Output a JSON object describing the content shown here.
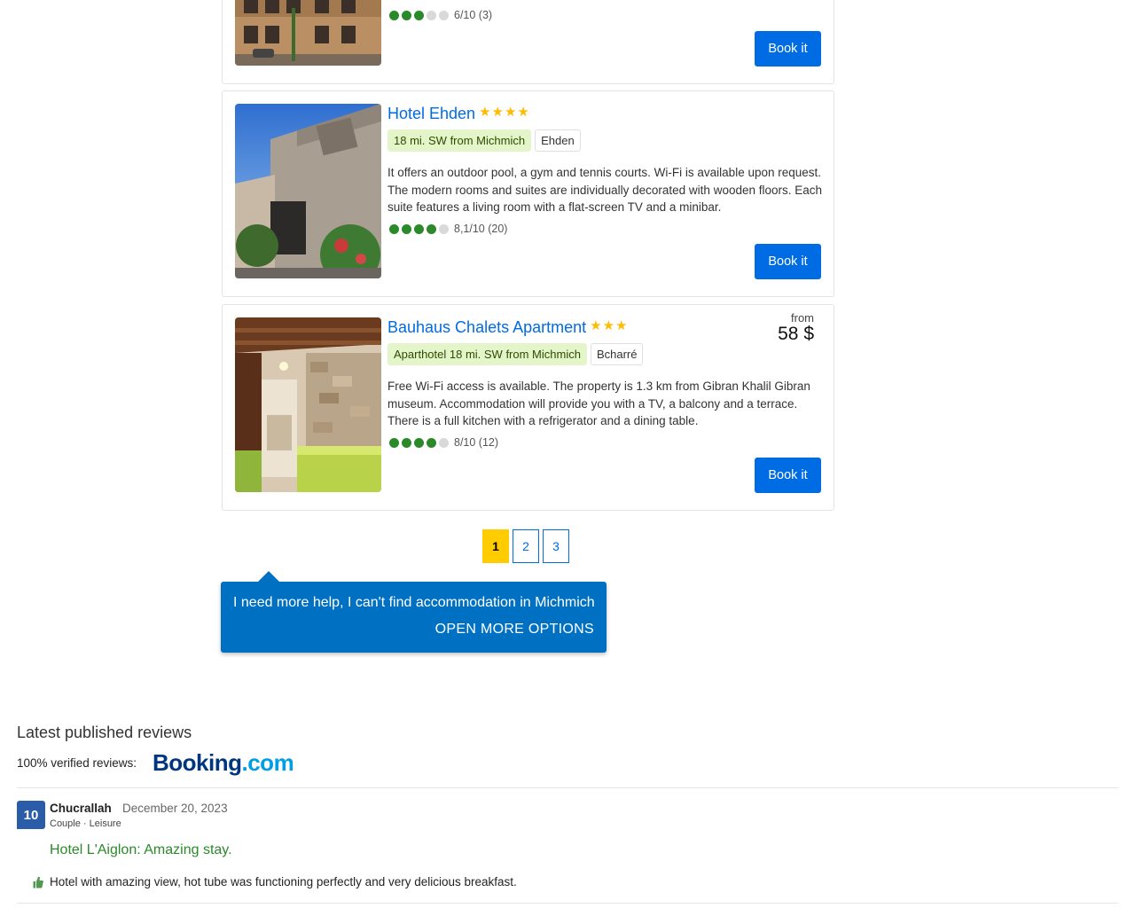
{
  "hotels": [
    {
      "rating_score": "6/10 (3)",
      "rating_dots": 3,
      "book_label": "Book it"
    },
    {
      "name": "Hotel Ehden",
      "stars": "★★★★",
      "location_tag": "18 mi. SW from Michmich",
      "city_tag": "Ehden",
      "description": "It offers an outdoor pool, a gym and tennis courts. Wi-Fi is available upon request. The modern rooms and suites are individually decorated with wooden floors. Each suite features a living room with a flat-screen TV and a minibar.",
      "rating_score": "8,1/10 (20)",
      "rating_dots": 4,
      "book_label": "Book it"
    },
    {
      "name": "Bauhaus Chalets Apartment",
      "stars": "★★★",
      "location_tag": "Aparthotel 18 mi. SW from Michmich",
      "city_tag": "Bcharré",
      "description": "Free Wi-Fi access is available. The property is 1.3 km from Gibran Khalil Gibran museum. Accommodation will provide you with a TV, a balcony and a terrace. There is a full kitchen with a refrigerator and a dining table.",
      "price_from": "from",
      "price": "58 $",
      "rating_score": "8/10 (12)",
      "rating_dots": 4,
      "book_label": "Book it"
    }
  ],
  "pagination": {
    "pages": [
      "1",
      "2",
      "3"
    ],
    "current": "1"
  },
  "help": {
    "text": "I need more help, I can't find accommodation in Michmich",
    "link": "OPEN MORE OPTIONS"
  },
  "reviews": {
    "title": "Latest published reviews",
    "verified_label": "100% verified reviews:",
    "provider_logo_part1": "Booking",
    "provider_logo_part2": ".com",
    "items": [
      {
        "score": "10",
        "author": "Chucrallah",
        "date": "December 20, 2023",
        "meta": "Couple · Leisure",
        "hotel": "Hotel L'Aiglon",
        "headline": ": Amazing stay.",
        "positive": "Hotel with amazing view, hot tube was functioning perfectly and very delicious breakfast."
      }
    ]
  },
  "colors": {
    "link_blue": "#006ce4",
    "rating_green": "#2a8a2a",
    "star_yellow": "#febb02",
    "page_active": "#ffcc00",
    "help_bg": "#0071c2",
    "score_bg": "#2b5ca8"
  }
}
